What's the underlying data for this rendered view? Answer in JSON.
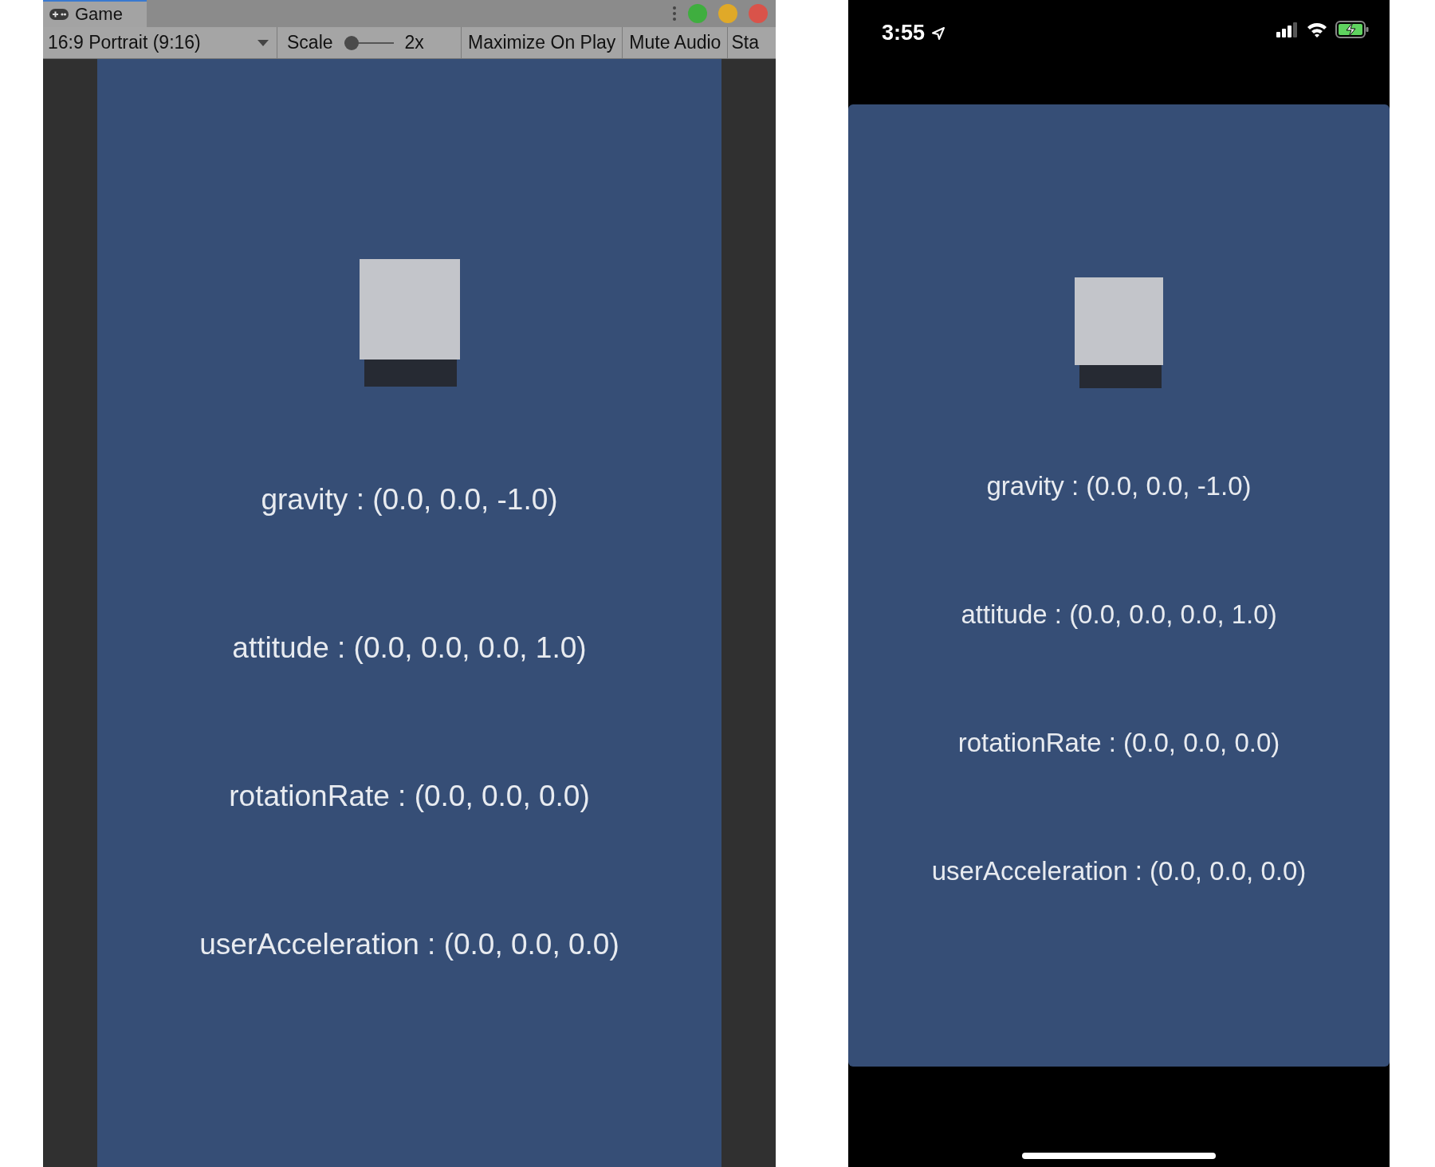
{
  "editor": {
    "tab": {
      "label": "Game",
      "selected": true
    },
    "aspect_dropdown": "16:9 Portrait (9:16)",
    "scale": {
      "label": "Scale",
      "level": 0,
      "reading": "2x"
    },
    "buttons": [
      "Maximize On Play",
      "Mute Audio",
      "Sta"
    ]
  },
  "game_view": {
    "readouts": [
      "gravity : (0.0, 0.0, -1.0)",
      "attitude : (0.0, 0.0, 0.0, 1.0)",
      "rotationRate : (0.0, 0.0, 0.0)",
      "userAcceleration : (0.0, 0.0, 0.0)"
    ]
  },
  "phone": {
    "status_bar": {
      "time": "3:55"
    },
    "readouts": [
      "gravity : (0.0, 0.0, -1.0)",
      "attitude : (0.0, 0.0, 0.0, 1.0)",
      "rotationRate : (0.0, 0.0, 0.0)",
      "userAcceleration : (0.0, 0.0, 0.0)"
    ]
  }
}
